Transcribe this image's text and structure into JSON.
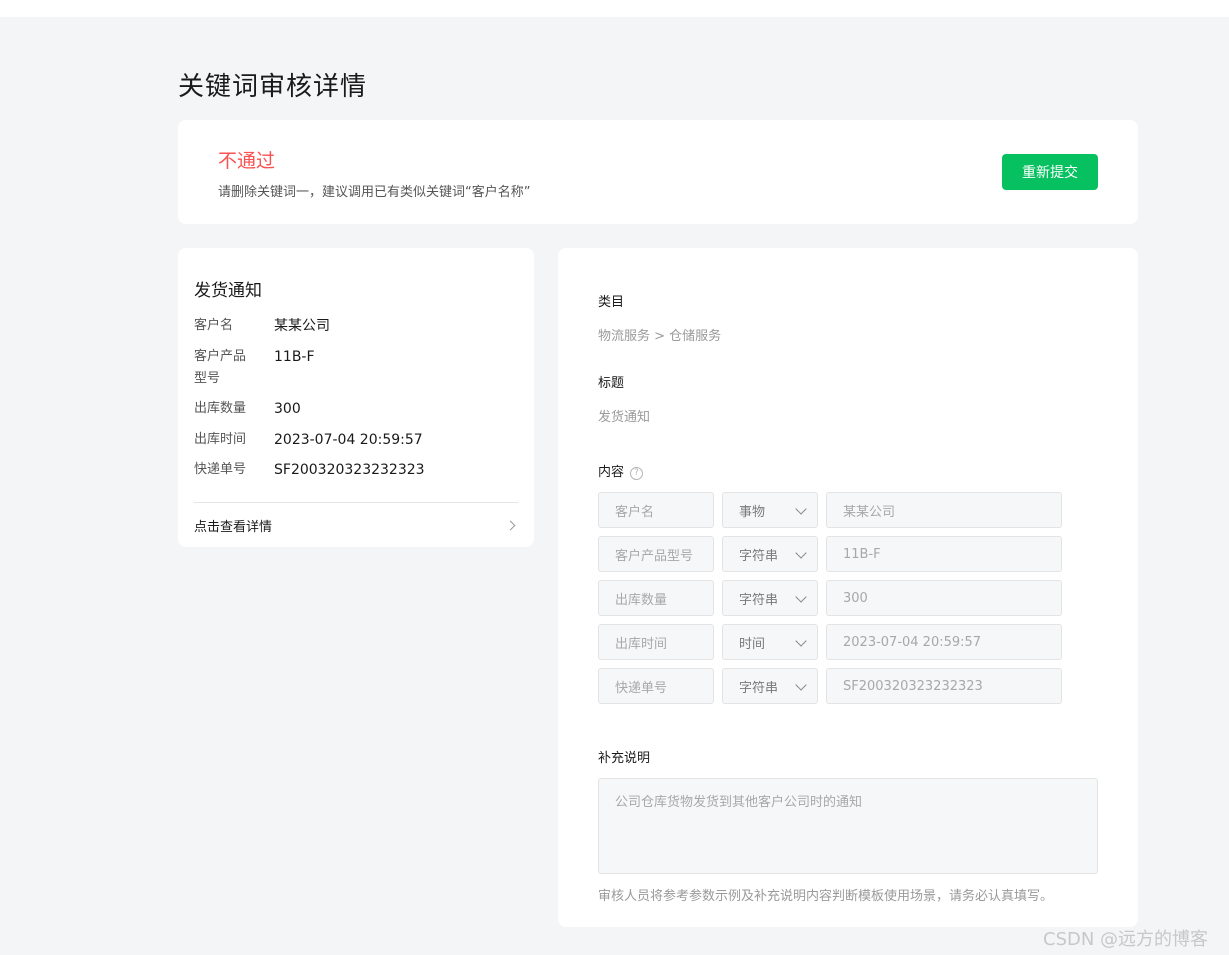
{
  "page": {
    "title": "关键词审核详情"
  },
  "status": {
    "text": "不通过",
    "reason": "请删除关键词一，建议调用已有类似关键词“客户名称”",
    "resubmit_label": "重新提交"
  },
  "preview": {
    "title": "发货通知",
    "fields": [
      {
        "label": "客户名",
        "value": "某某公司"
      },
      {
        "label": "客户产品型号",
        "value": "11B-F"
      },
      {
        "label": "出库数量",
        "value": "300"
      },
      {
        "label": "出库时间",
        "value": "2023-07-04 20:59:57"
      },
      {
        "label": "快递单号",
        "value": "SF200320323232323"
      }
    ],
    "view_detail_label": "点击查看详情"
  },
  "detail": {
    "category_label": "类目",
    "category_value": "物流服务 > 仓储服务",
    "title_label": "标题",
    "title_value": "发货通知",
    "content_label": "内容",
    "content_help_icon": "?",
    "params": [
      {
        "name": "客户名",
        "type": "事物",
        "value": "某某公司"
      },
      {
        "name": "客户产品型号",
        "type": "字符串",
        "value": "11B-F"
      },
      {
        "name": "出库数量",
        "type": "字符串",
        "value": "300"
      },
      {
        "name": "出库时间",
        "type": "时间",
        "value": "2023-07-04 20:59:57"
      },
      {
        "name": "快递单号",
        "type": "字符串",
        "value": "SF200320323232323"
      }
    ],
    "remark_label": "补充说明",
    "remark_value": "公司仓库货物发货到其他客户公司时的通知",
    "remark_hint": "审核人员将参考参数示例及补充说明内容判断模板使用场景，请务必认真填写。"
  },
  "watermark": "CSDN @远方的博客",
  "colors": {
    "fail_red": "#fa5151",
    "brand_green": "#07c160",
    "background": "#f4f5f7"
  }
}
